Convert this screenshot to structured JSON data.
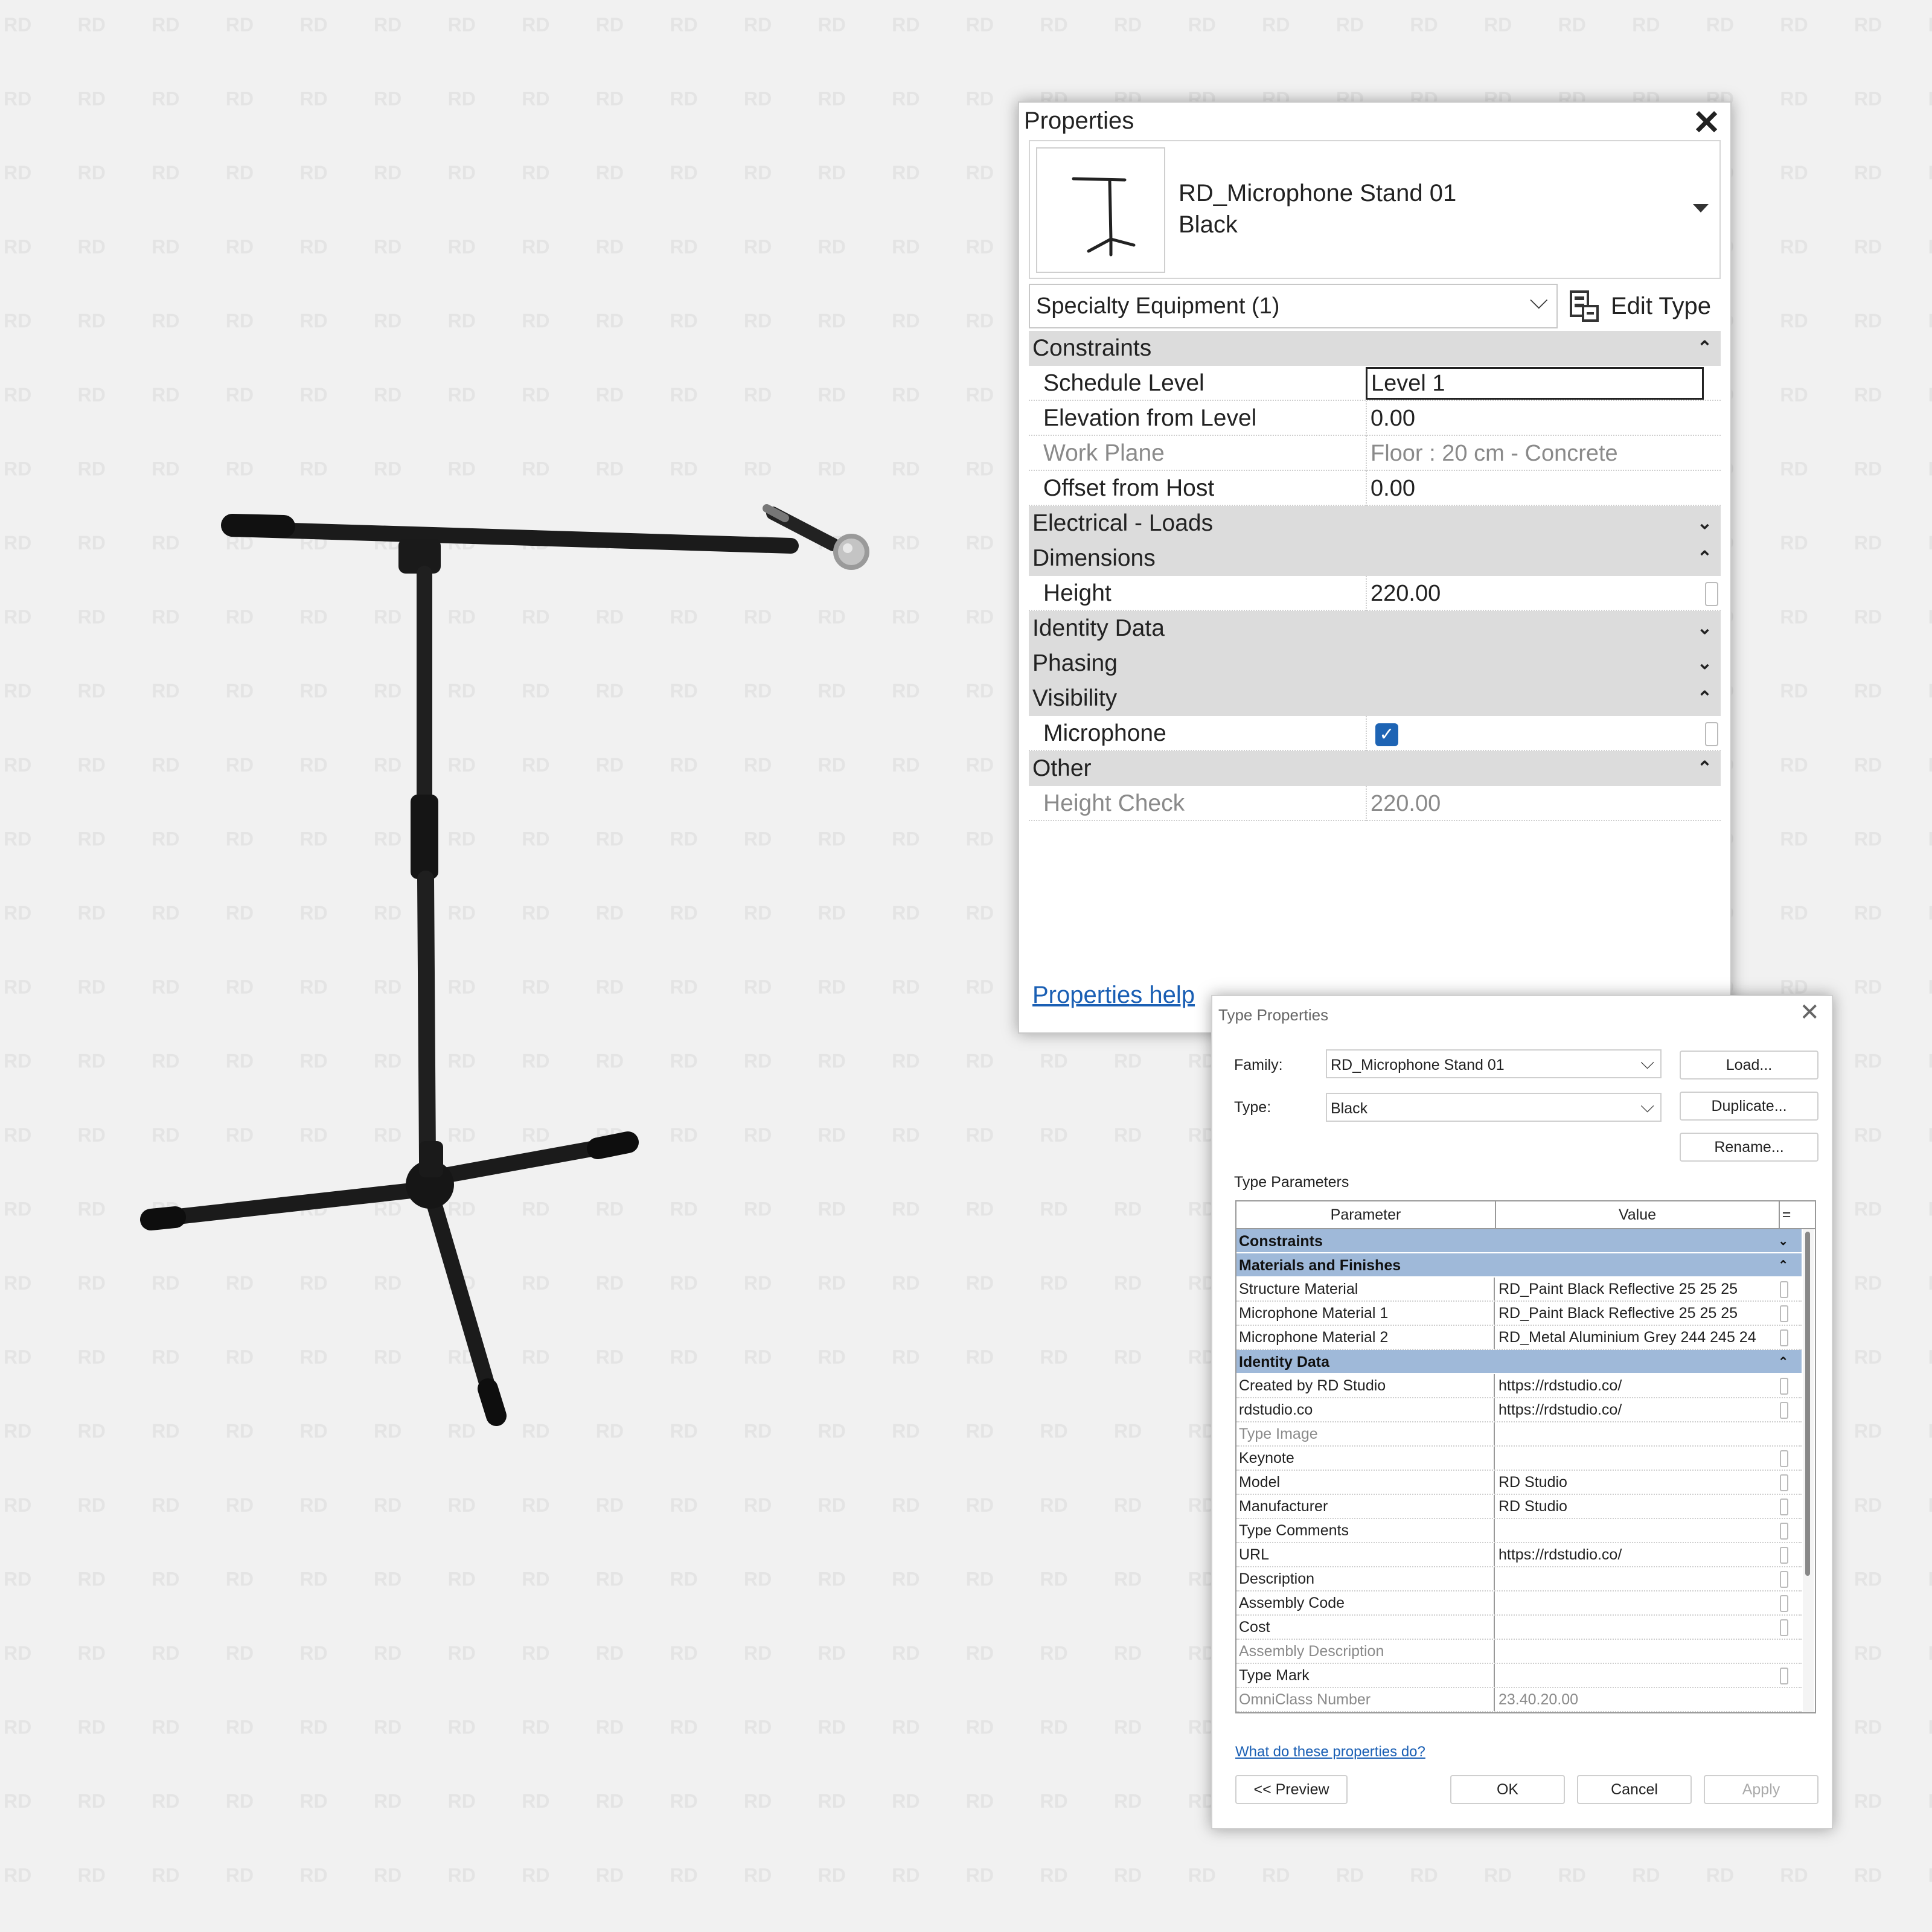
{
  "watermark": "RD",
  "properties": {
    "title": "Properties",
    "close_glyph": "✕",
    "family_line1": "RD_Microphone Stand 01",
    "family_line2": "Black",
    "category": "Specialty Equipment (1)",
    "edit_type": "Edit Type",
    "groups": {
      "constraints": "Constraints",
      "electrical": "Electrical - Loads",
      "dimensions": "Dimensions",
      "identity": "Identity Data",
      "phasing": "Phasing",
      "visibility": "Visibility",
      "other": "Other"
    },
    "rows": {
      "schedule_level": {
        "label": "Schedule Level",
        "value": "Level 1"
      },
      "elevation": {
        "label": "Elevation from Level",
        "value": "0.00"
      },
      "work_plane": {
        "label": "Work Plane",
        "value": "Floor : 20 cm - Concrete"
      },
      "offset": {
        "label": "Offset from Host",
        "value": "0.00"
      },
      "height": {
        "label": "Height",
        "value": "220.00"
      },
      "microphone": {
        "label": "Microphone",
        "checked": true
      },
      "height_check": {
        "label": "Height Check",
        "value": "220.00"
      }
    },
    "help": "Properties help"
  },
  "type_properties": {
    "title": "Type Properties",
    "close_glyph": "✕",
    "family_label": "Family:",
    "family_value": "RD_Microphone Stand 01",
    "type_label": "Type:",
    "type_value": "Black",
    "load": "Load...",
    "duplicate": "Duplicate...",
    "rename": "Rename...",
    "type_params": "Type Parameters",
    "col_parameter": "Parameter",
    "col_value": "Value",
    "col_eq": "=",
    "groups": {
      "constraints": "Constraints",
      "materials": "Materials and Finishes",
      "identity": "Identity Data"
    },
    "materials": [
      {
        "p": "Structure Material",
        "v": "RD_Paint Black Reflective 25 25 25"
      },
      {
        "p": "Microphone Material 1",
        "v": "RD_Paint Black Reflective 25 25 25"
      },
      {
        "p": "Microphone Material 2",
        "v": "RD_Metal Aluminium Grey 244 245 24"
      }
    ],
    "identity": [
      {
        "p": "Created by RD Studio",
        "v": "https://rdstudio.co/"
      },
      {
        "p": "rdstudio.co",
        "v": "https://rdstudio.co/"
      },
      {
        "p": "Type Image",
        "v": ""
      },
      {
        "p": "Keynote",
        "v": ""
      },
      {
        "p": "Model",
        "v": "RD Studio"
      },
      {
        "p": "Manufacturer",
        "v": "RD Studio"
      },
      {
        "p": "Type Comments",
        "v": ""
      },
      {
        "p": "URL",
        "v": "https://rdstudio.co/"
      },
      {
        "p": "Description",
        "v": ""
      },
      {
        "p": "Assembly Code",
        "v": ""
      },
      {
        "p": "Cost",
        "v": ""
      },
      {
        "p": "Assembly Description",
        "v": ""
      },
      {
        "p": "Type Mark",
        "v": ""
      },
      {
        "p": "OmniClass Number",
        "v": "23.40.20.00"
      }
    ],
    "help": "What do these properties do?",
    "preview": "<< Preview",
    "ok": "OK",
    "cancel": "Cancel",
    "apply": "Apply"
  }
}
